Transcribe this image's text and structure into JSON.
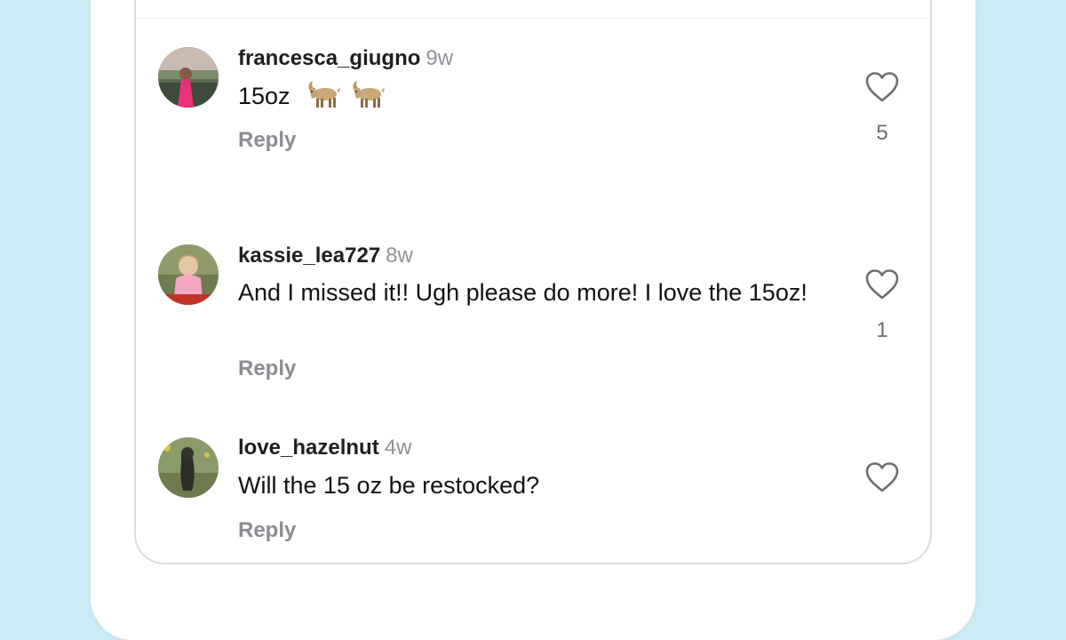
{
  "comments": [
    {
      "username": "francesca_giugno",
      "time": "9w",
      "text": "15oz",
      "emojis": [
        "goat",
        "goat"
      ],
      "reply_label": "Reply",
      "likes": "5",
      "avatar_icon": "person-pink-dress-photo"
    },
    {
      "username": "kassie_lea727",
      "time": "8w",
      "text": "And I missed it!! Ugh please do more! I love the 15oz!",
      "reply_label": "Reply",
      "likes": "1",
      "avatar_icon": "child-photo"
    },
    {
      "username": "love_hazelnut",
      "time": "4w",
      "text": "Will the 15 oz be restocked?",
      "reply_label": "Reply",
      "avatar_icon": "dog-photo"
    }
  ],
  "colors": {
    "background": "#cdebf5",
    "username": "#1c1e21",
    "meta": "#8e9297"
  }
}
